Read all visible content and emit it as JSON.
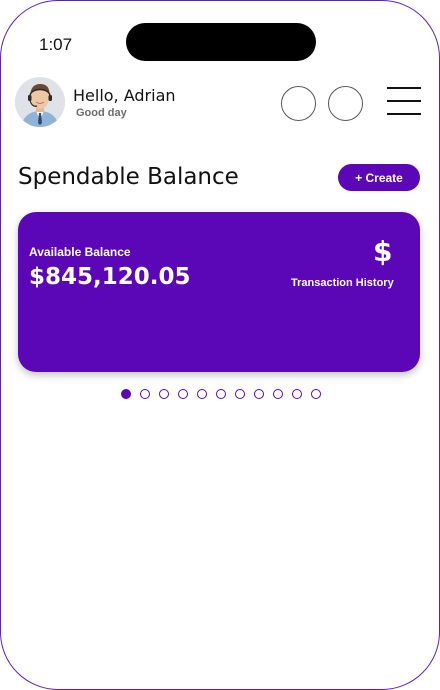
{
  "status": {
    "time": "1:07"
  },
  "header": {
    "greeting": "Hello, Adrian",
    "subgreeting": "Good day"
  },
  "balance_section": {
    "title": "Spendable Balance",
    "create_label": "+ Create"
  },
  "card": {
    "label": "Available Balance",
    "amount": "$845,120.05",
    "currency_symbol": "$",
    "history_label": "Transaction History",
    "color": "#5b07b8"
  },
  "carousel": {
    "total": 11,
    "active_index": 0
  },
  "icons": {
    "avatar": "user-avatar",
    "circle_buttons": [
      "circle-button",
      "circle-button"
    ],
    "menu": "hamburger-menu-icon"
  }
}
